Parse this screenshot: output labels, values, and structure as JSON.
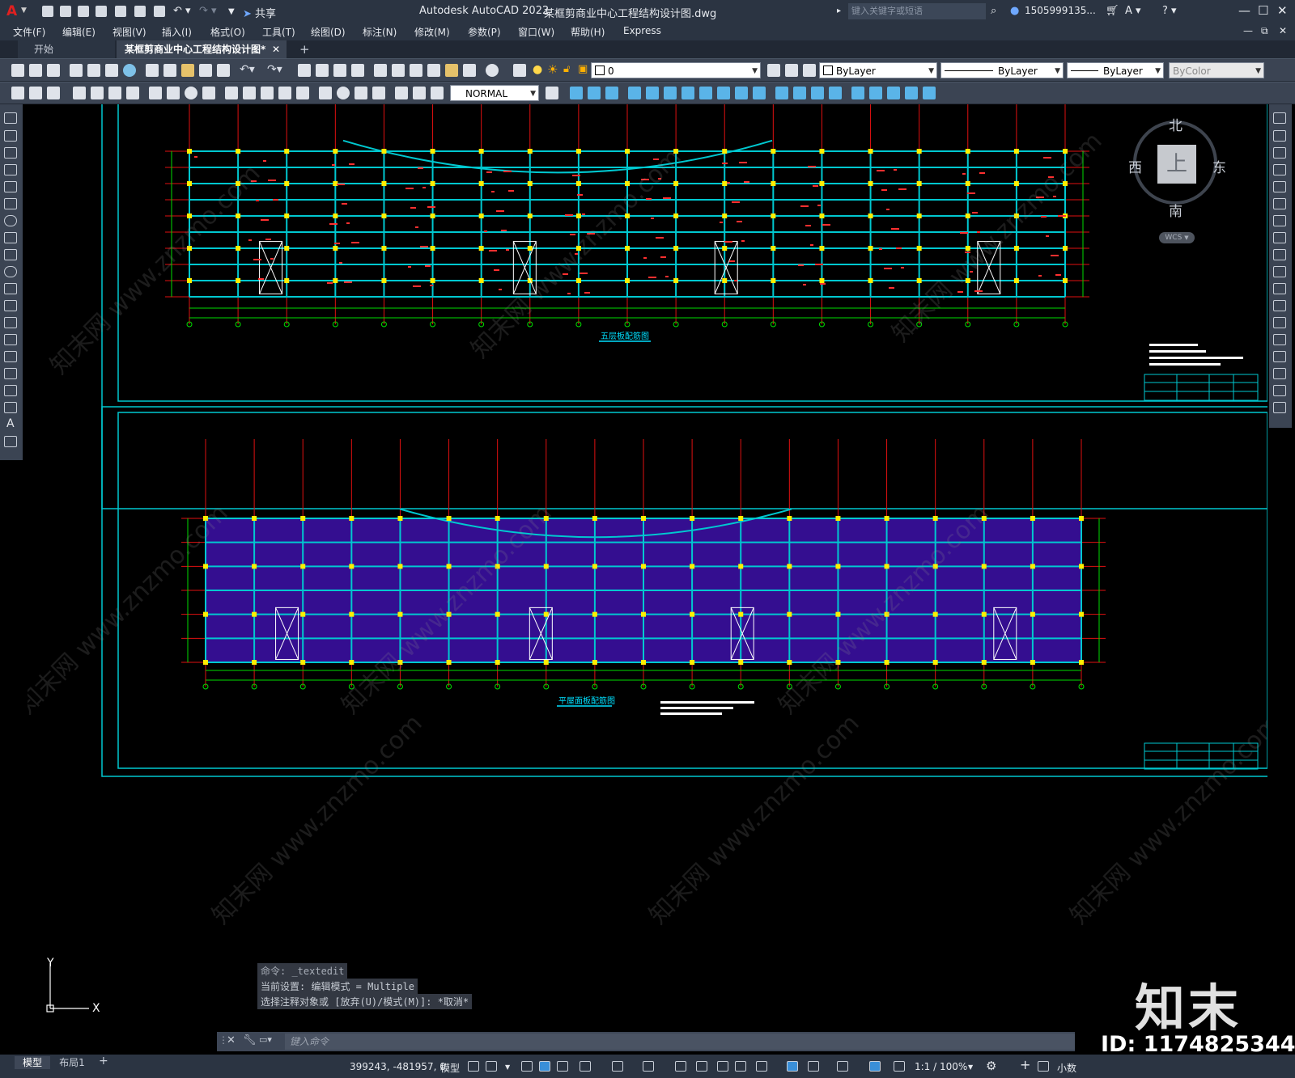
{
  "app": {
    "title": "Autodesk AutoCAD 2022",
    "document": "某框剪商业中心工程结构设计图.dwg",
    "search_placeholder": "键入关键字或短语",
    "user": "1505999135...",
    "share_label": "共享"
  },
  "menus": [
    "文件(F)",
    "编辑(E)",
    "视图(V)",
    "插入(I)",
    "格式(O)",
    "工具(T)",
    "绘图(D)",
    "标注(N)",
    "修改(M)",
    "参数(P)",
    "窗口(W)",
    "帮助(H)",
    "Express"
  ],
  "tabs": [
    {
      "label": "开始",
      "active": false
    },
    {
      "label": "某框剪商业中心工程结构设计图*",
      "active": true
    }
  ],
  "layer": {
    "current": "0"
  },
  "properties": {
    "color": "ByLayer",
    "linetype": "ByLayer",
    "lineweight": "ByLayer",
    "plotstyle": "ByColor"
  },
  "dimstyle": "NORMAL",
  "viewcube": {
    "north": "北",
    "south": "南",
    "east": "东",
    "west": "西",
    "face": "上",
    "wcs": "WCS"
  },
  "drawing": {
    "plan1_title": "五层板配筋图",
    "plan2_title": "平屋面板配筋图",
    "ucs_x": "X",
    "ucs_y": "Y"
  },
  "command": {
    "history": [
      "命令: _textedit",
      "当前设置: 编辑模式 = Multiple",
      "选择注释对象或 [放弃(U)/模式(M)]: *取消*"
    ],
    "prompt": "键入命令"
  },
  "layout_tabs": [
    "模型",
    "布局1"
  ],
  "status": {
    "coords": "399243, -481957, 0",
    "model": "模型",
    "scale": "1:1 / 100%",
    "units": "小数"
  },
  "watermark": {
    "brand": "知末",
    "id": "ID: 1174825344",
    "site": "www.znzmo.com",
    "site_cn": "知末网"
  },
  "colors": {
    "title_bg": "#2b3442",
    "toolbar_bg": "#3b4453",
    "canvas_bg": "#000000",
    "grid_red": "#e01010",
    "grid_green": "#00dd00",
    "frame_cyan": "#00c8d0",
    "column_yellow": "#ffee00",
    "slab_purple": "#3a10a0"
  }
}
